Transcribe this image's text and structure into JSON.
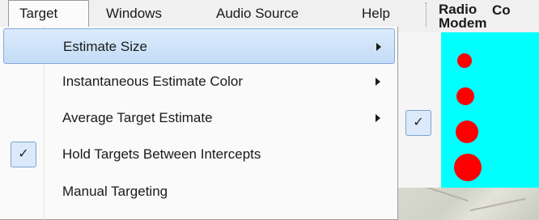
{
  "menubar": {
    "items": [
      "Target",
      "Windows",
      "Audio Source",
      "Help"
    ],
    "open_index": 0
  },
  "right_panel": {
    "heading_bold": "Radio Modem",
    "heading_cut": "Co"
  },
  "target_menu": {
    "items": [
      {
        "label": "Estimate Size",
        "has_submenu": true,
        "checked": false,
        "highlighted": true
      },
      {
        "label": "Instantaneous Estimate Color",
        "has_submenu": true,
        "checked": false,
        "highlighted": false
      },
      {
        "label": "Average Target Estimate",
        "has_submenu": true,
        "checked": false,
        "highlighted": false
      },
      {
        "label": "Hold Targets Between Intercepts",
        "has_submenu": false,
        "checked": true,
        "highlighted": false
      },
      {
        "label": "Manual Targeting",
        "has_submenu": false,
        "checked": false,
        "highlighted": false
      }
    ]
  },
  "estimate_size_submenu": {
    "options": [
      {
        "size": "small",
        "checked": false
      },
      {
        "size": "medium",
        "checked": false
      },
      {
        "size": "large",
        "checked": true
      },
      {
        "size": "extra-large",
        "checked": false
      }
    ],
    "dot_color": "#ff0000",
    "background_color": "#00ffff"
  },
  "glyphs": {
    "check": "✓"
  },
  "colors": {
    "menu_highlight": "#c3dcf6",
    "menu_highlight_border": "#84acdd"
  }
}
